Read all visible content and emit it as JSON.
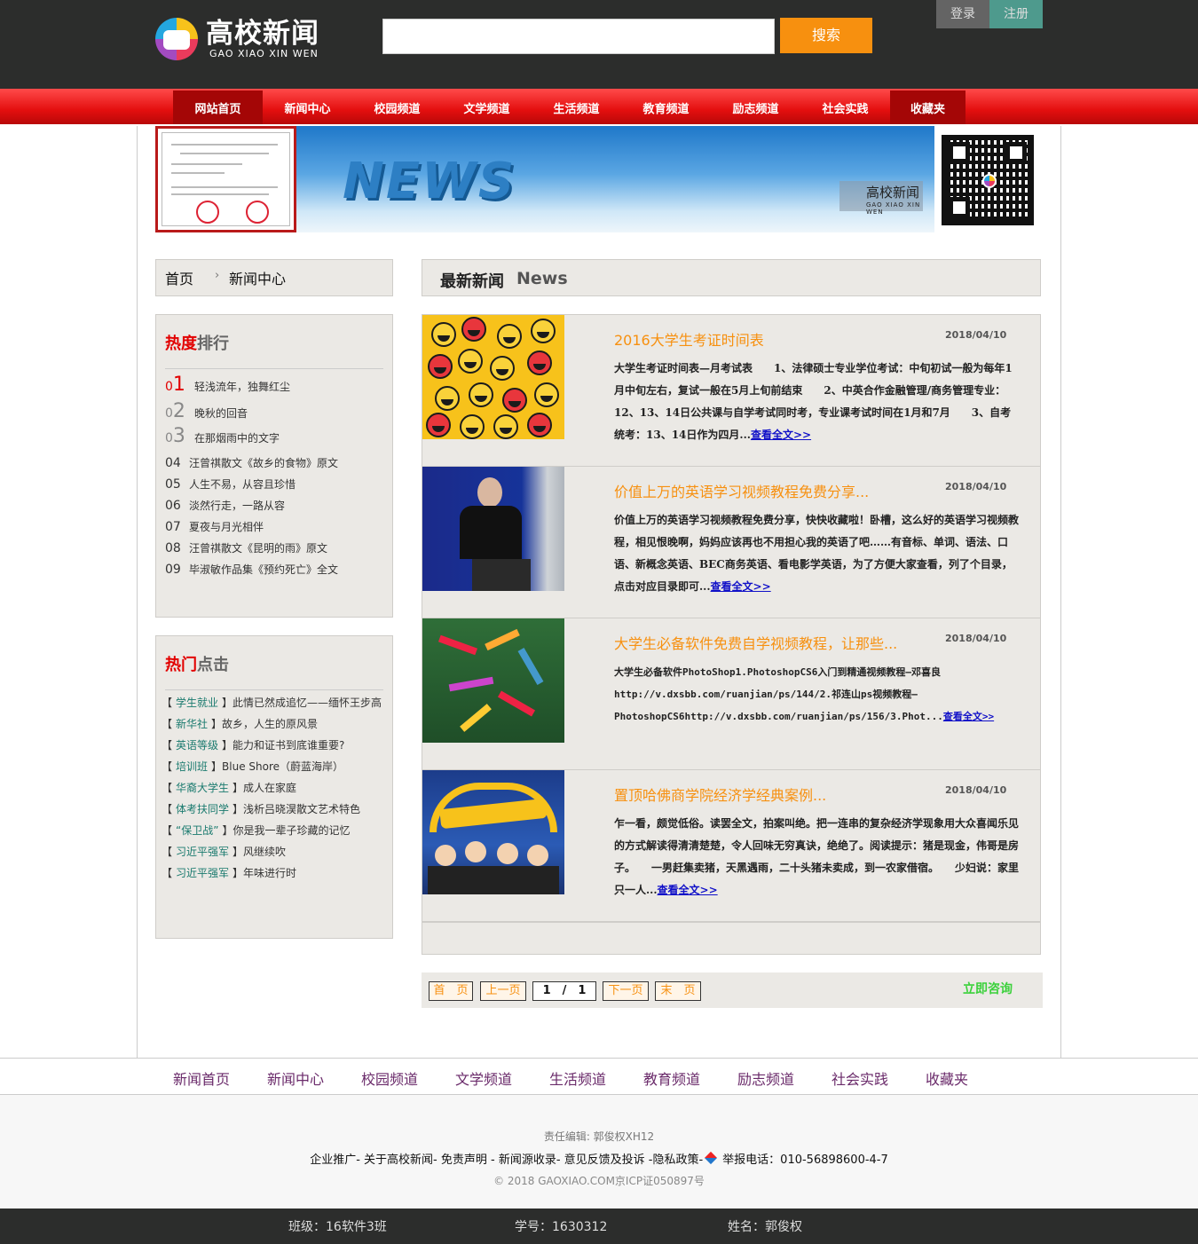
{
  "header": {
    "logo_title": "高校新闻",
    "logo_subtitle": "GAO XIAO XIN WEN",
    "search_placeholder": "",
    "search_button": "搜索",
    "login": "登录",
    "register": "注册"
  },
  "nav": [
    "网站首页",
    "新闻中心",
    "校园频道",
    "文学频道",
    "生活频道",
    "教育频道",
    "励志频道",
    "社会实践",
    "收藏夹"
  ],
  "banner": {
    "word": "NEWS",
    "label": "高校新闻",
    "label_sub": "GAO XIAO XIN WEN"
  },
  "breadcrumb": {
    "home": "首页",
    "sep": "›",
    "current": "新闻中心"
  },
  "hot_rank": {
    "title_red": "热度",
    "title_gray": "排行",
    "items": [
      {
        "num": "01",
        "text": "轻浅流年，独舞红尘"
      },
      {
        "num": "02",
        "text": "晚秋的回音"
      },
      {
        "num": "03",
        "text": "在那烟雨中的文字"
      },
      {
        "num": "04",
        "text": "汪曾祺散文《故乡的食物》原文"
      },
      {
        "num": "05",
        "text": "人生不易，从容且珍惜"
      },
      {
        "num": "06",
        "text": "淡然行走，一路从容"
      },
      {
        "num": "07",
        "text": "夏夜与月光相伴"
      },
      {
        "num": "08",
        "text": "汪曾祺散文《昆明的雨》原文"
      },
      {
        "num": "09",
        "text": "毕淑敏作品集《预约死亡》全文"
      }
    ]
  },
  "hot_click": {
    "title_red": "热门",
    "title_gray": "点击",
    "items": [
      {
        "tag": "学生就业",
        "text": "此情已然成追忆——缅怀王步高"
      },
      {
        "tag": "新华社",
        "text": "故乡，人生的原风景"
      },
      {
        "tag": "英语等级",
        "text": "能力和证书到底谁重要?"
      },
      {
        "tag": "培训班",
        "text": "Blue Shore（蔚蓝海岸）"
      },
      {
        "tag": "华裔大学生",
        "text": "成人在家庭"
      },
      {
        "tag": "体考扶同学",
        "text": "浅析吕晓淏散文艺术特色"
      },
      {
        "tag": "“保卫战”",
        "text": "你是我一辈子珍藏的记忆"
      },
      {
        "tag": "习近平强军",
        "text": "风继续吹"
      },
      {
        "tag": "习近平强军",
        "text": "年味进行时"
      }
    ]
  },
  "news": {
    "title_cn": "最新新闻",
    "title_en": "News",
    "more_label": "查看全文>>",
    "items": [
      {
        "title": "2016大学生考证时间表",
        "date": "2018/04/10",
        "body": "大学生考证时间表—月考试表　　1、法律硕士专业学位考试：中旬初试一般为每年1月中旬左右，复试一般在5月上旬前结束　　2、中英合作金融管理/商务管理专业：12、13、14日公共课与自学考试同时考，专业课考试时间在1月和7月　　3、自考统考：13、14日作为四月..."
      },
      {
        "title": "价值上万的英语学习视频教程免费分享...",
        "date": "2018/04/10",
        "body": "价值上万的英语学习视频教程免费分享，快快收藏啦！卧槽，这么好的英语学习视频教程，相见恨晚啊，妈妈应该再也不用担心我的英语了吧……有音标、单词、语法、口语、新概念英语、BEC商务英语、看电影学英语，为了方便大家查看，列了个目录，点击对应目录即可..."
      },
      {
        "title": "大学生必备软件免费自学视频教程，让那些...",
        "date": "2018/04/10",
        "body": "大学生必备软件PhotoShop1.PhotoshopCS6入门到精通视频教程—邓喜良http://v.dxsbb.com/ruanjian/ps/144/2.祁连山ps视频教程—PhotoshopCS6http://v.dxsbb.com/ruanjian/ps/156/3.Phot..."
      },
      {
        "title": "置顶哈佛商学院经济学经典案例...",
        "date": "2018/04/10",
        "body": "乍一看，颇觉低俗。读罢全文，拍案叫绝。把一连串的复杂经济学现象用大众喜闻乐见的方式解读得清清楚楚，令人回味无穷真诀，绝绝了。阅读提示：猪是现金，伟哥是房子。　　一男赶集卖猪，天黑遇雨，二十头猪未卖成，到一农家借宿。　　少妇说：家里只一人..."
      }
    ]
  },
  "pager": {
    "first": "首　页",
    "prev": "上一页",
    "current": "1　/　1",
    "next": "下一页",
    "last": "末　页",
    "consult": "立即咨询"
  },
  "footer": {
    "nav": [
      "新闻首页",
      "新闻中心",
      "校园频道",
      "文学频道",
      "生活频道",
      "教育频道",
      "励志频道",
      "社会实践",
      "收藏夹"
    ],
    "editor": "责任编辑: 郭俊权XH12",
    "links_text": "企业推广- 关于高校新闻- 免责声明 - 新闻源收录- 意见反馈及投诉 -隐私政策-",
    "report": "举报电话：010-56898600-4-7",
    "copyright": "© 2018 GAOXIAO.COM京ICP证050897号",
    "class_label": "班级：16软件3班",
    "id_label": "学号：1630312",
    "name_label": "姓名：郭俊权"
  },
  "colors": {
    "nav_red": "#e40f0f",
    "accent_orange": "#f7900f",
    "dark_header": "#2c2d2c",
    "panel": "#ebe9e5"
  }
}
